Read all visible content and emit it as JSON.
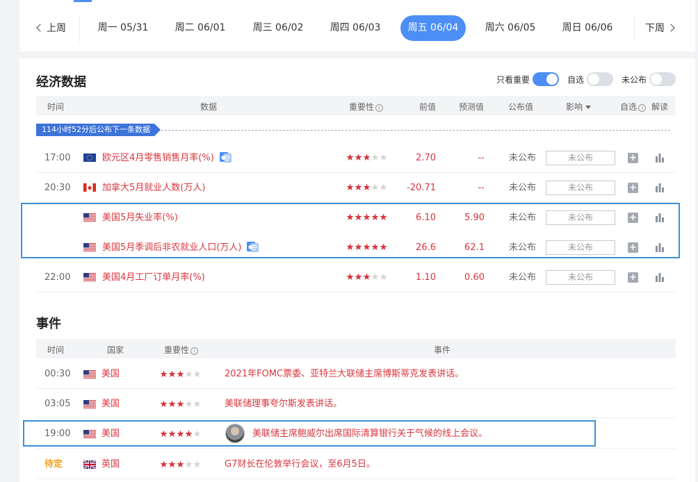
{
  "week": {
    "prev_label": "上周",
    "next_label": "下周",
    "days": [
      {
        "label": "周一 05/31",
        "active": false
      },
      {
        "label": "周二 06/01",
        "active": false
      },
      {
        "label": "周三 06/02",
        "active": false
      },
      {
        "label": "周四 06/03",
        "active": false
      },
      {
        "label": "周五 06/04",
        "active": true
      },
      {
        "label": "周六 06/05",
        "active": false
      },
      {
        "label": "周日 06/06",
        "active": false
      }
    ]
  },
  "econ": {
    "title": "经济数据",
    "toggles": [
      {
        "label": "只看重要",
        "on": true
      },
      {
        "label": "自选",
        "on": false
      },
      {
        "label": "未公布",
        "on": false
      }
    ],
    "headers": {
      "time": "时间",
      "data": "数据",
      "importance": "重要性",
      "previous": "前值",
      "forecast": "预测值",
      "actual": "公布值",
      "impact": "影响",
      "watch": "自选",
      "interpret": "解读"
    },
    "countdown": "114小时52分后公布下一条数据",
    "rows": [
      {
        "time": "17:00",
        "flag": "eu-flag",
        "name": "欧元区4月零售销售月率(%)",
        "has_doc": true,
        "stars": 3,
        "previous": "2.70",
        "forecast": "--",
        "actual": "未公布",
        "impact_box": "未公布"
      },
      {
        "time": "20:30",
        "flag": "ca-flag",
        "name": "加拿大5月就业人数(万人)",
        "has_doc": false,
        "stars": 3,
        "previous": "-20.71",
        "forecast": "--",
        "actual": "未公布",
        "impact_box": "未公布"
      },
      {
        "time": "",
        "flag": "us-flag",
        "name": "美国5月失业率(%)",
        "has_doc": false,
        "stars": 5,
        "previous": "6.10",
        "forecast": "5.90",
        "actual": "未公布",
        "impact_box": "未公布"
      },
      {
        "time": "",
        "flag": "us-flag",
        "name": "美国5月季调后非农就业人口(万人)",
        "has_doc": true,
        "stars": 5,
        "previous": "26.6",
        "forecast": "62.1",
        "actual": "未公布",
        "impact_box": "未公布"
      },
      {
        "time": "22:00",
        "flag": "us-flag",
        "name": "美国4月工厂订单月率(%)",
        "has_doc": false,
        "stars": 3,
        "previous": "1.10",
        "forecast": "0.60",
        "actual": "未公布",
        "impact_box": "未公布"
      }
    ]
  },
  "events": {
    "title": "事件",
    "headers": {
      "time": "时间",
      "country": "国家",
      "importance": "重要性",
      "event": "事件"
    },
    "rows": [
      {
        "time": "00:30",
        "pending": false,
        "flag": "us-flag",
        "country": "美国",
        "stars": 3,
        "avatar": false,
        "text": "2021年FOMC票委、亚特兰大联储主席博斯蒂克发表讲话。"
      },
      {
        "time": "03:05",
        "pending": false,
        "flag": "us-flag",
        "country": "美国",
        "stars": 3,
        "avatar": false,
        "text": "美联储理事夸尔斯发表讲话。"
      },
      {
        "time": "19:00",
        "pending": false,
        "flag": "us-flag",
        "country": "美国",
        "stars": 4,
        "avatar": true,
        "text": "美联储主席鲍威尔出席国际清算银行关于气候的线上会议。"
      },
      {
        "time": "待定",
        "pending": true,
        "flag": "uk-flag",
        "country": "英国",
        "stars": 3,
        "avatar": false,
        "text": "G7财长在伦敦举行会议，至6月5日。"
      }
    ]
  },
  "colors": {
    "accent": "#4d8ef6",
    "data_red": "#d9363e",
    "highlight_border": "#3a8fd6",
    "pending": "#f0a020"
  }
}
